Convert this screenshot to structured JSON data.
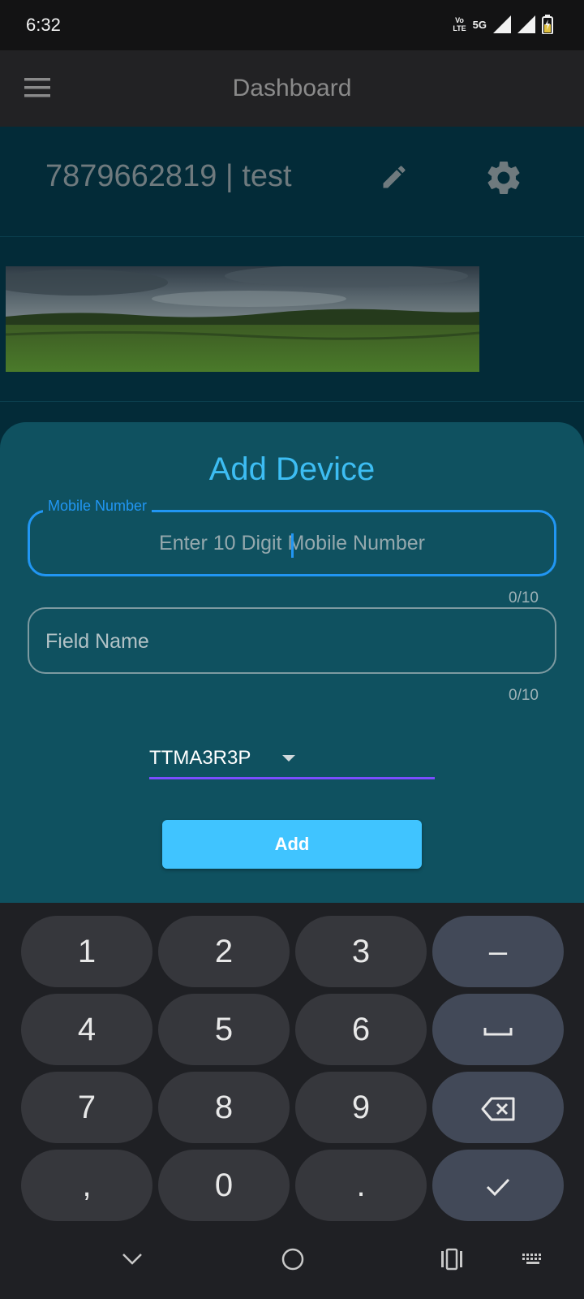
{
  "status_bar": {
    "time": "6:32",
    "volte_top": "Vo",
    "volte_bottom": "LTE",
    "network": "5G",
    "icons": [
      "signal-icon",
      "signal-icon",
      "battery-charging-icon"
    ]
  },
  "app_bar": {
    "title": "Dashboard",
    "menu_icon": "hamburger-menu-icon"
  },
  "header": {
    "text": "7879662819 | test",
    "edit_icon": "edit-pencil-icon",
    "settings_icon": "gear-icon"
  },
  "sheet": {
    "title": "Add Device",
    "mobile": {
      "label": "Mobile Number",
      "placeholder": "Enter 10 Digit Mobile Number",
      "counter": "0/10"
    },
    "field_name": {
      "placeholder": "Field Name",
      "counter": "0/10"
    },
    "dropdown": {
      "value": "TTMA3R3P"
    },
    "add_button": "Add"
  },
  "keyboard": {
    "keys": [
      "1",
      "2",
      "3",
      "–",
      "4",
      "5",
      "6",
      "␣",
      "7",
      "8",
      "9",
      "⌫",
      ",",
      "0",
      ".",
      "✓"
    ]
  },
  "nav_bar": {
    "icons": [
      "chevron-down-icon",
      "home-circle-icon",
      "recents-icon",
      "keyboard-icon"
    ]
  },
  "colors": {
    "accent_blue": "#2196f3",
    "title_cyan": "#3dbdf3",
    "button_bg": "#40c4ff",
    "dropdown_underline": "#7c4dff",
    "sheet_bg": "#0f5160"
  }
}
